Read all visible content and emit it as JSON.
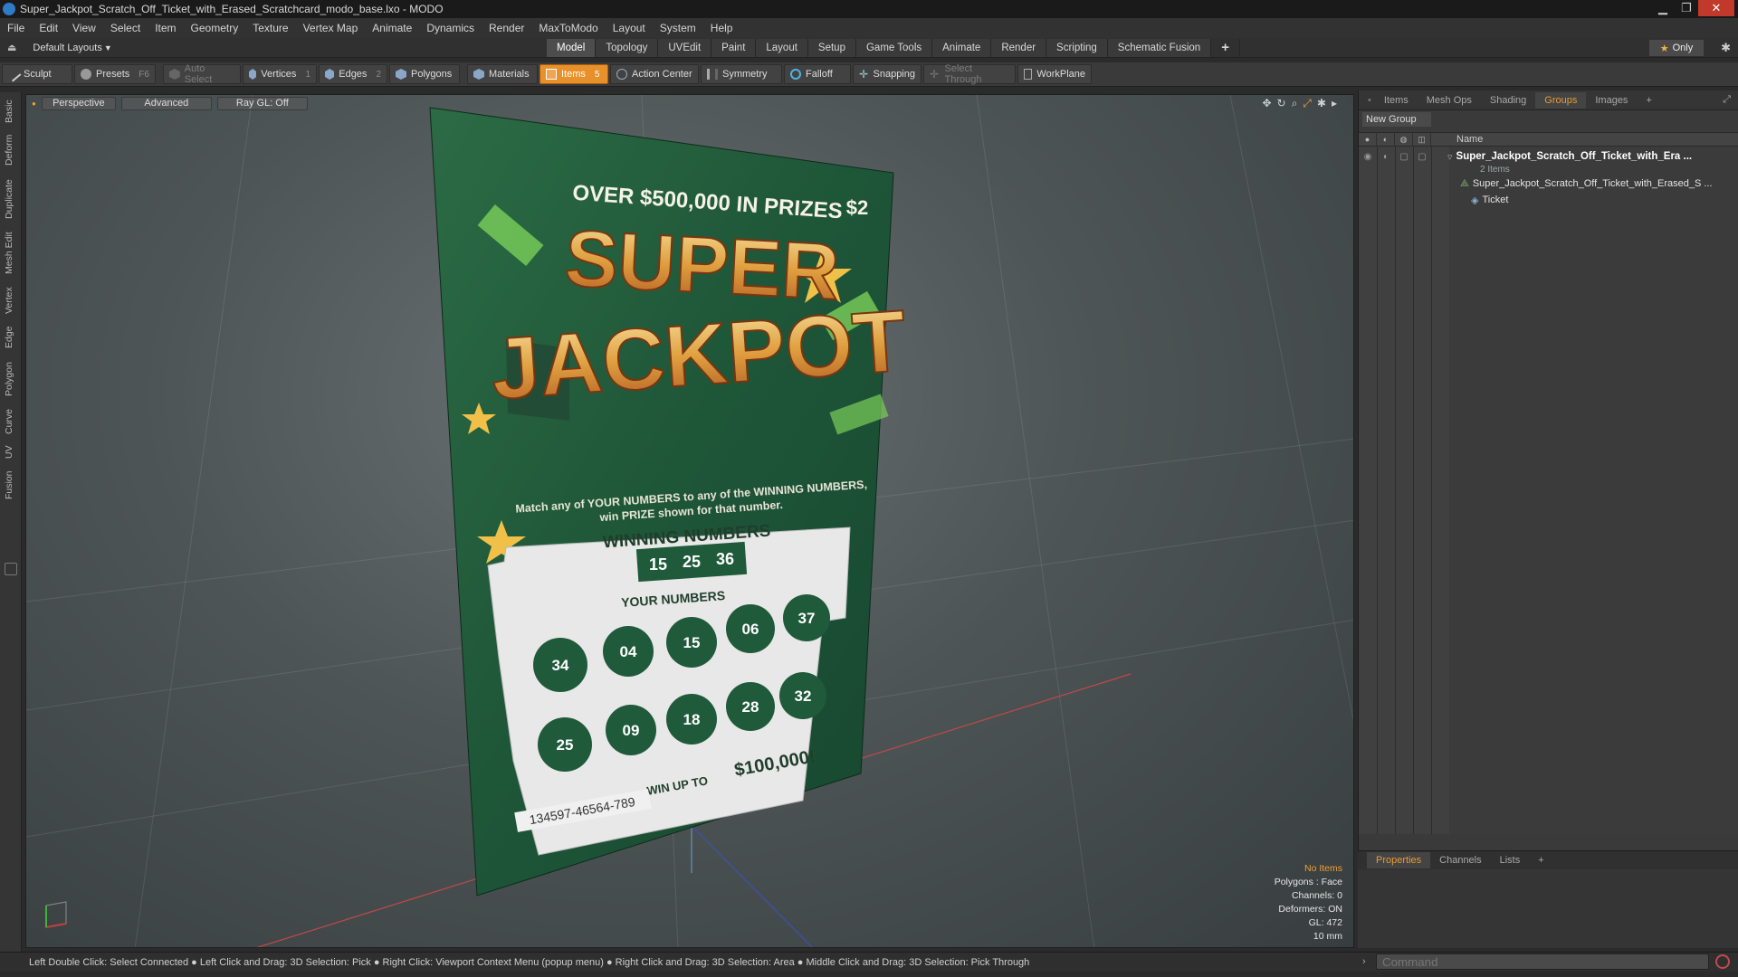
{
  "titlebar": {
    "title": "Super_Jackpot_Scratch_Off_Ticket_with_Erased_Scratchcard_modo_base.lxo - MODO"
  },
  "menu": [
    "File",
    "Edit",
    "View",
    "Select",
    "Item",
    "Geometry",
    "Texture",
    "Vertex Map",
    "Animate",
    "Dynamics",
    "Render",
    "MaxToModo",
    "Layout",
    "System",
    "Help"
  ],
  "layout": {
    "selector": "Default Layouts",
    "tabs": [
      "Model",
      "Topology",
      "UVEdit",
      "Paint",
      "Layout",
      "Setup",
      "Game Tools",
      "Animate",
      "Render",
      "Scripting",
      "Schematic Fusion"
    ],
    "active_tab": "Model",
    "only_label": "Only"
  },
  "toolbar": {
    "sculpt": "Sculpt",
    "presets": "Presets",
    "presets_key": "F6",
    "auto_select": "Auto Select",
    "vertices": "Vertices",
    "vertices_key": "1",
    "edges": "Edges",
    "edges_key": "2",
    "polygons": "Polygons",
    "materials": "Materials",
    "items": "Items",
    "items_key": "5",
    "action_center": "Action Center",
    "symmetry": "Symmetry",
    "falloff": "Falloff",
    "snapping": "Snapping",
    "select_through": "Select Through",
    "workplane": "WorkPlane"
  },
  "left_rail": [
    "Basic",
    "Deform",
    "Duplicate",
    "Mesh Edit",
    "Vertex",
    "Edge",
    "Polygon",
    "Curve",
    "UV",
    "Fusion"
  ],
  "viewport": {
    "view": "Perspective",
    "shading": "Advanced",
    "raygl": "Ray GL: Off",
    "stats": {
      "items": "No Items",
      "polygons": "Polygons : Face",
      "channels": "Channels: 0",
      "deformers": "Deformers: ON",
      "gl": "GL: 472",
      "scale": "10 mm"
    }
  },
  "ticket": {
    "top": "OVER $500,000 IN PRIZES",
    "price": "$2",
    "title1": "SUPER",
    "title2": "JACKPOT",
    "instr1": "Match any of YOUR NUMBERS to any of the WINNING NUMBERS,",
    "instr2": "win PRIZE shown for that number.",
    "winning_head": "WINNING NUMBERS",
    "winning": [
      "15",
      "25",
      "36"
    ],
    "your_head": "YOUR NUMBERS",
    "yours": [
      "34",
      "04",
      "15",
      "06",
      "37",
      "25",
      "09",
      "18",
      "28",
      "32"
    ],
    "win_up": "WIN UP TO",
    "win_amt": "$100,000!",
    "serial": "134597-46564-789"
  },
  "right_panel": {
    "tabs": [
      "Items",
      "Mesh Ops",
      "Shading",
      "Groups",
      "Images"
    ],
    "active_tab": "Groups",
    "new_group": "New Group",
    "name_col": "Name",
    "group_name": "Super_Jackpot_Scratch_Off_Ticket_with_Era ...",
    "group_count": "2 Items",
    "child1": "Super_Jackpot_Scratch_Off_Ticket_with_Erased_S ...",
    "child2": "Ticket"
  },
  "properties": {
    "tabs": [
      "Properties",
      "Channels",
      "Lists"
    ],
    "active_tab": "Properties"
  },
  "statusbar": {
    "hint": "Left Double Click: Select Connected ● Left Click and Drag: 3D Selection: Pick ● Right Click: Viewport Context Menu (popup menu) ● Right Click and Drag: 3D Selection: Area ● Middle Click and Drag: 3D Selection: Pick Through"
  },
  "command": {
    "placeholder": "Command"
  },
  "colors": {
    "accent": "#e8902a",
    "ticket_green": "#1f5a3a",
    "gold": "#e9b24a"
  }
}
